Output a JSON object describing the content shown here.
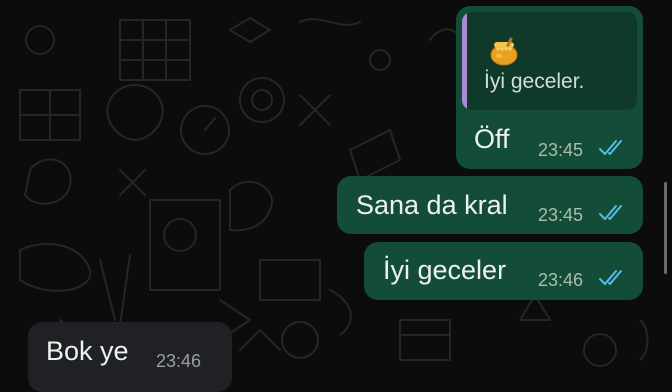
{
  "chat": {
    "messages": [
      {
        "direction": "outgoing",
        "quote": {
          "text": "İyi geceler.",
          "icon": "honey-pot-emoji"
        },
        "text": "Öff",
        "time": "23:45",
        "status": "read"
      },
      {
        "direction": "outgoing",
        "text": "Sana da kral",
        "time": "23:45",
        "status": "read"
      },
      {
        "direction": "outgoing",
        "text": "İyi geceler",
        "time": "23:46",
        "status": "read"
      },
      {
        "direction": "incoming",
        "text": "Bok ye",
        "time": "23:46"
      }
    ]
  },
  "colors": {
    "outgoing_bubble": "#144d37",
    "incoming_bubble": "#1f2125",
    "read_ticks": "#53bdeb",
    "quote_bar": "#a78bd6",
    "background": "#0c0c0c"
  }
}
